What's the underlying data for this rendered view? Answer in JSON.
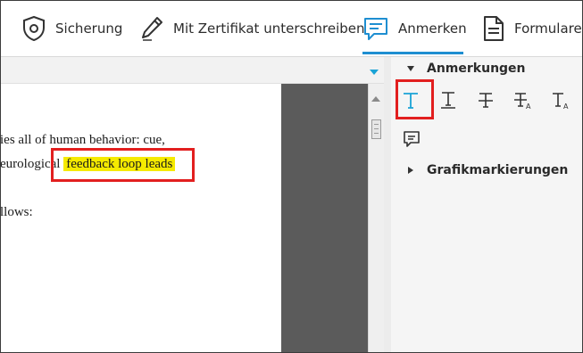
{
  "toolbar": {
    "items": [
      {
        "label": "Sicherung",
        "icon": "shield-icon"
      },
      {
        "label": "Mit Zertifikat unterschreiben",
        "icon": "pen-icon"
      },
      {
        "label": "Anmerken",
        "icon": "comment-icon",
        "active": true
      },
      {
        "label": "Formulare",
        "icon": "form-document-icon"
      }
    ]
  },
  "document": {
    "lines": [
      {
        "text": "ies all of human behavior: cue,"
      },
      {
        "text_before": "eurological ",
        "highlight": "feedback loop leads"
      },
      {
        "text": "llows:"
      }
    ]
  },
  "panel": {
    "anmerkungen": {
      "title": "Anmerkungen",
      "tools": [
        "text-highlight-icon",
        "text-underline-icon",
        "text-strikethrough-icon",
        "replace-text-icon",
        "insert-text-icon",
        "comment-note-icon"
      ]
    },
    "grafik": {
      "title": "Grafikmarkierungen"
    }
  },
  "colors": {
    "accent": "#1e8ed1",
    "highlight": "#f5ea00",
    "callout": "#e21f1f"
  }
}
